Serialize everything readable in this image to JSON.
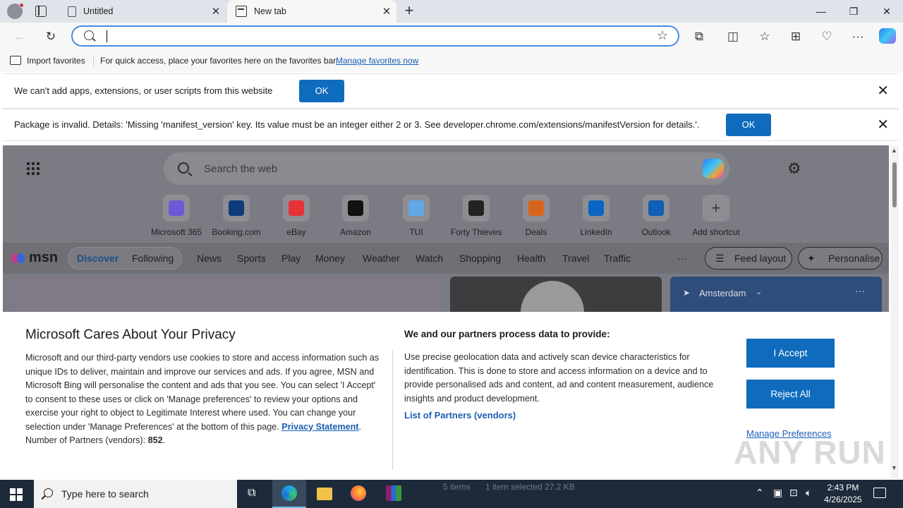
{
  "browser": {
    "tabs": [
      {
        "title": "Untitled"
      },
      {
        "title": "New tab"
      }
    ],
    "address": {
      "value": "",
      "placeholder": ""
    },
    "favorites_bar": {
      "import_label": "Import favorites",
      "message": "For quick access, place your favorites here on the favorites bar.",
      "manage_link": "Manage favorites now"
    }
  },
  "infobars": [
    {
      "text": "We can't add apps, extensions, or user scripts from this website",
      "button": "OK"
    },
    {
      "text": "Package is invalid. Details: 'Missing 'manifest_version' key. Its value must be an integer either 2 or 3. See developer.chrome.com/extensions/manifestVersion for details.'.",
      "button": "OK"
    }
  ],
  "ntp": {
    "search_placeholder": "Search the web",
    "shortcuts": [
      {
        "label": "Microsoft 365",
        "icon": "microsoft-365-icon",
        "color": "#6b5bd6"
      },
      {
        "label": "Booking.com",
        "icon": "booking-icon",
        "color": "#0c3b7c"
      },
      {
        "label": "eBay",
        "icon": "ebay-icon",
        "color": "#e53238"
      },
      {
        "label": "Amazon",
        "icon": "amazon-icon",
        "color": "#111111"
      },
      {
        "label": "TUI",
        "icon": "tui-icon",
        "color": "#62a8e5"
      },
      {
        "label": "Forty Thieves",
        "icon": "forty-thieves-icon",
        "color": "#222222"
      },
      {
        "label": "Deals",
        "icon": "deals-icon",
        "color": "#d9651c"
      },
      {
        "label": "LinkedIn",
        "icon": "linkedin-icon",
        "color": "#0a66c2"
      },
      {
        "label": "Outlook",
        "icon": "outlook-icon",
        "color": "#0f5fb5"
      },
      {
        "label": "Add shortcut",
        "icon": "plus-icon",
        "color": "#333333"
      }
    ],
    "msn": {
      "logo": "msn",
      "discover": "Discover",
      "following": "Following",
      "nav": [
        "News",
        "Sports",
        "Play",
        "Money",
        "Weather",
        "Watch",
        "Shopping",
        "Health",
        "Travel",
        "Traffic"
      ],
      "more": "···",
      "feed_layout": "Feed layout",
      "personalise": "Personalise",
      "weather_city": "Amsterdam"
    }
  },
  "privacy": {
    "title": "Microsoft Cares About Your Privacy",
    "left_text": "Microsoft and our third-party vendors use cookies to store and access information such as unique IDs to deliver, maintain and improve our services and ads. If you agree, MSN and Microsoft Bing will personalise the content and ads that you see. You can select 'I Accept' to consent to these uses or click on 'Manage preferences' to review your options and exercise your right to object to Legitimate Interest where used.  You can change your selection under 'Manage Preferences' at the bottom of this page.",
    "privacy_link": "Privacy Statement",
    "partners_count_label": "Number of Partners (vendors):",
    "partners_count": "852",
    "right_title": "We and our partners process data to provide:",
    "right_text": "Use precise geolocation data and actively scan device characteristics for identification. This is done to store and access information on a device and to provide personalised ads and content, ad and content measurement, audience insights and product development.",
    "partners_link": "List of Partners (vendors)",
    "accept": "I Accept",
    "reject": "Reject All",
    "manage": "Manage Preferences",
    "watermark": "ANY RUN"
  },
  "taskbar": {
    "search_placeholder": "Type here to search",
    "status_items": "5 items",
    "status_selected": "1 item selected  27.2 KB",
    "time": "2:43 PM",
    "date": "4/26/2025"
  }
}
